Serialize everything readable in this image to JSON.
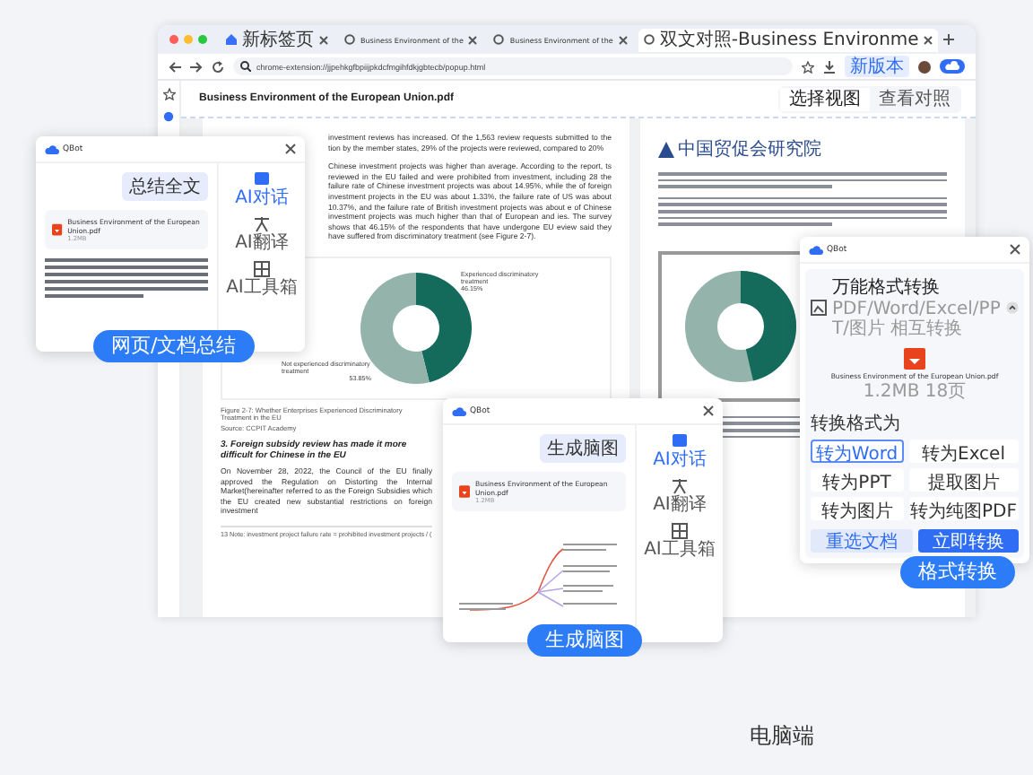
{
  "browser": {
    "tabs": [
      {
        "title": "新标签页",
        "selected": false
      },
      {
        "title": "Business Environment of the",
        "selected": false
      },
      {
        "title": "Business Environment of the",
        "selected": false
      },
      {
        "title": "双文对照-Business Environme",
        "selected": true
      }
    ],
    "address": "chrome-extension://jjpehkgfbpiijpkdcfmgihfdkjgbtecb/popup.html",
    "version_button": "新版本"
  },
  "document": {
    "title": "Business Environment of the European Union.pdf",
    "view_buttons": [
      {
        "label": "选择视图",
        "selected": true
      },
      {
        "label": "查看对照",
        "selected": false
      }
    ],
    "english_page": {
      "paragraphs": [
        "investment reviews has increased. Of the 1,563 review requests submitted to the tion by the member states, 29% of the projects were reviewed, compared to 20%",
        "Chinese investment projects was higher than average. According to the report, ts reviewed in the EU failed and were prohibited from investment, including 28 the failure rate of Chinese investment projects was about 14.95%, while the of foreign investment projects in the EU was about 1.33%, the failure rate of US was about 10.37%, and the failure rate of British investment projects was about e of Chinese investment projects was much higher than that of European and ies. The survey shows that 46.15% of the respondents that have undergone EU eview said they have suffered from discriminatory treatment (see Figure 2-7)."
      ],
      "chart_data": {
        "type": "donut",
        "categories": [
          "Experienced discriminatory treatment",
          "Not experienced discriminatory treatment"
        ],
        "values": [
          46.15,
          53.85
        ],
        "colors": [
          "#146b5c",
          "#93b3ab"
        ],
        "value_labels": [
          "46.15%",
          "53.85%"
        ]
      },
      "figure_caption": "Figure 2-7: Whether Enterprises Experienced Discriminatory Treatment in the EU",
      "figure_source": "Source: CCPIT Academy",
      "heading": "3. Foreign subsidy review has made it more difficult for Chinese in the EU",
      "body": "On November 28, 2022, the Council of the EU finally approved the Regulation on Distorting the Internal Market(hereinafter referred to as the Foreign Subsidies which the EU created new substantial restrictions on foreign investment",
      "footnote": "13 Note: investment project failure rate = prohibited investment projects / ("
    },
    "chinese_page": {
      "logo_text": "中国贸促会研究院"
    }
  },
  "summary_panel": {
    "brand": "QBot",
    "request": "总结全文",
    "file": {
      "name": "Business Environment of the European Union.pdf",
      "size": "1.2MB"
    },
    "tools": [
      {
        "label": "AI对话",
        "selected": true
      },
      {
        "label": "AI翻译",
        "selected": false
      },
      {
        "label": "AI工具箱",
        "selected": false
      }
    ],
    "feature_label": "网页/文档总结"
  },
  "mindmap_panel": {
    "brand": "QBot",
    "request": "生成脑图",
    "file": {
      "name": "Business Environment of the European Union.pdf",
      "size": "1.2MB"
    },
    "tools": [
      {
        "label": "AI对话",
        "selected": true
      },
      {
        "label": "AI翻译",
        "selected": false
      },
      {
        "label": "AI工具箱",
        "selected": false
      }
    ],
    "feature_label": "生成脑图"
  },
  "convert_panel": {
    "brand": "QBot",
    "title": "万能格式转换",
    "subtitle": "PDF/Word/Excel/PPT/图片 相互转换",
    "file": {
      "name": "Business Environment of the European Union.pdf",
      "size": "1.2MB 18页"
    },
    "options_label": "转换格式为",
    "options": [
      {
        "label": "转为Word",
        "selected": true
      },
      {
        "label": "转为Excel",
        "selected": false
      },
      {
        "label": "转为PPT",
        "selected": false
      },
      {
        "label": "提取图片",
        "selected": false
      },
      {
        "label": "转为图片",
        "selected": false
      },
      {
        "label": "转为纯图PDF",
        "selected": false
      }
    ],
    "actions": [
      {
        "label": "重选文档",
        "kind": "secondary"
      },
      {
        "label": "立即转换",
        "kind": "primary"
      }
    ],
    "feature_label": "格式转换"
  },
  "caption": "电脑端"
}
